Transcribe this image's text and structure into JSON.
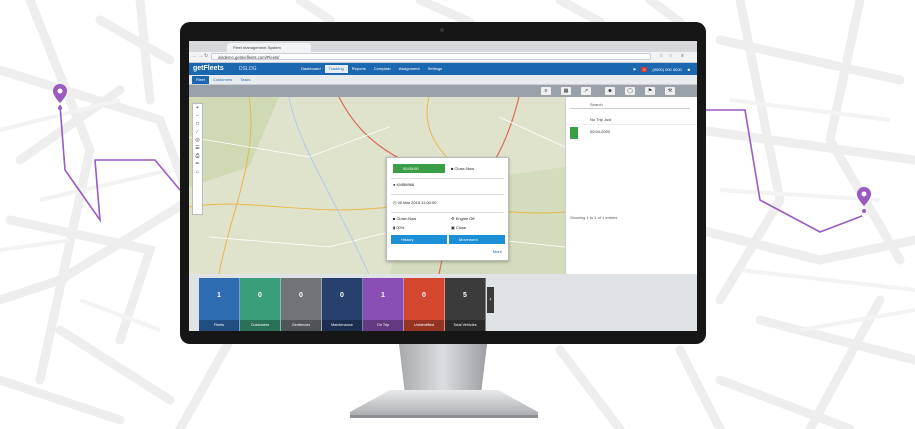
{
  "browser": {
    "tab_title": "Fleet management System",
    "url": "initdemo.getmefleets.com/Fleets/"
  },
  "app": {
    "logo": "getFleets",
    "company": "DSLOG",
    "menu": [
      "Dashboard",
      "Tracking",
      "Reports",
      "Complain",
      "Assignment",
      "Settings"
    ],
    "active_menu": "Tracking",
    "header_right": {
      "alert_count": "0",
      "phone": "(0000) 000 0000",
      "user_icon": "user-icon"
    },
    "subnav": [
      "Fleet",
      "Customers",
      "Tasks"
    ],
    "toolbar_icons": [
      "list-icon",
      "grid-icon",
      "pin-icon",
      "user-icon",
      "route-icon",
      "flag-icon",
      "wrench-icon"
    ]
  },
  "popup": {
    "time": "00:00:00",
    "status_btn": "Close-Now",
    "vehicle": "KMB8966",
    "datetime": "00 Mar 2015 11:00:00",
    "ignition": "Close-Now",
    "engine": "Engine Off",
    "battery": "00%",
    "door": "Close",
    "history_btn": "History",
    "movement_btn": "Movement",
    "more": "More"
  },
  "rpanel": {
    "search_placeholder": "Search",
    "row1": "No Trip Just",
    "row2": "00:00:2000",
    "footer": "Showing 1 to 1 of 1 entries"
  },
  "tiles": [
    {
      "count": "1",
      "label": "Fleets",
      "color": "#2f6db3"
    },
    {
      "count": "0",
      "label": "Customers",
      "color": "#3a9e7a"
    },
    {
      "count": "0",
      "label": "Geofences",
      "color": "#6f7479"
    },
    {
      "count": "0",
      "label": "Maintenance",
      "color": "#26416e"
    },
    {
      "count": "1",
      "label": "On Trip",
      "color": "#8a4fb5"
    },
    {
      "count": "0",
      "label": "Unidentified",
      "color": "#d2472e"
    },
    {
      "count": "5",
      "label": "Total Vehicles",
      "color": "#3b3b3b"
    }
  ],
  "colors": {
    "accent": "#1c68b0",
    "pin": "#9b59c2"
  }
}
